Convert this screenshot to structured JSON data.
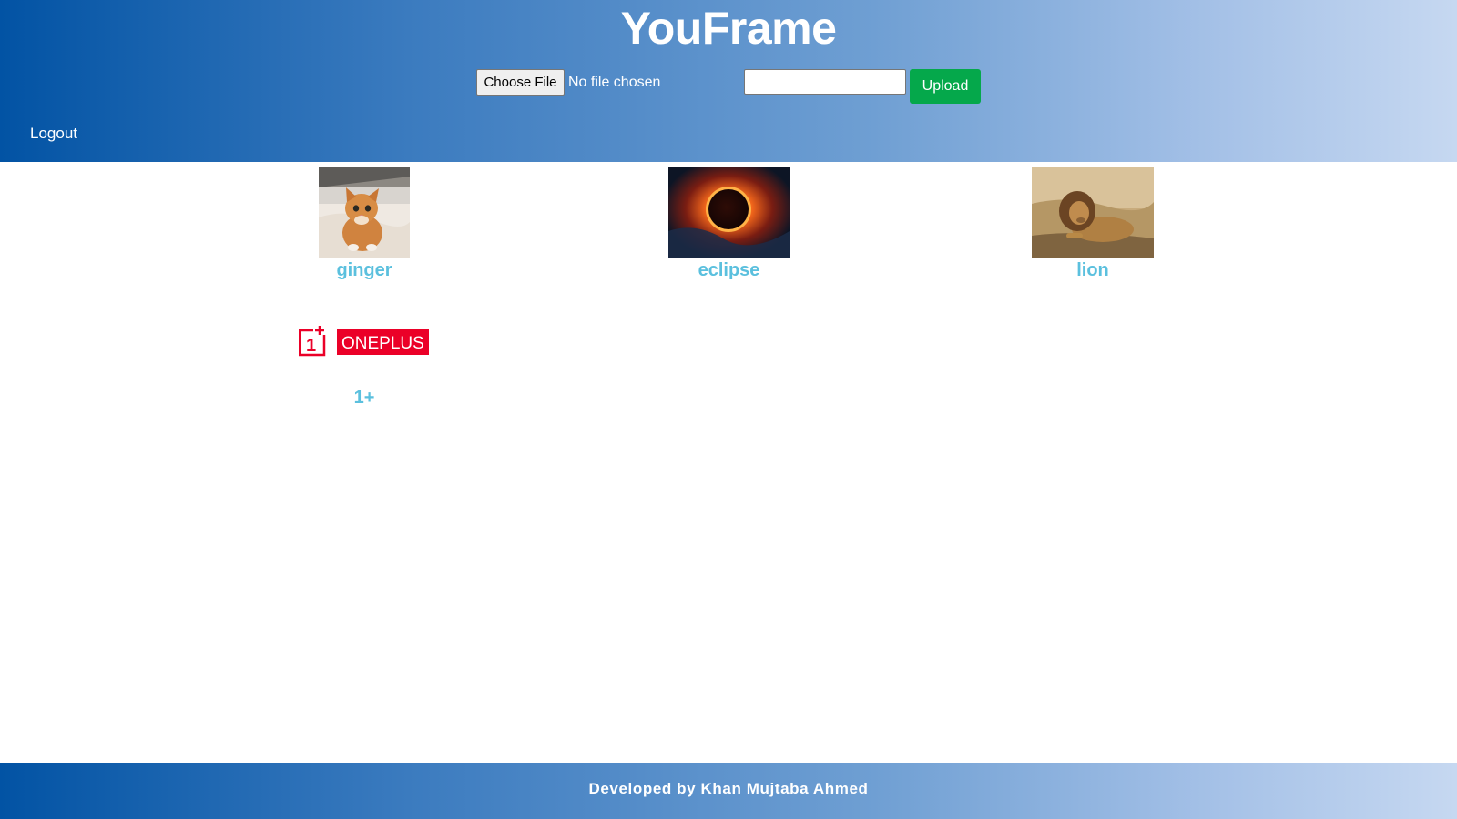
{
  "header": {
    "title": "YouFrame",
    "file_button_label": "Choose File",
    "file_status": "No file chosen",
    "name_input_value": "",
    "upload_label": "Upload",
    "logout_label": "Logout"
  },
  "gallery": {
    "items": [
      {
        "label": "ginger",
        "image": "orange-kitten-photo"
      },
      {
        "label": "eclipse",
        "image": "solar-eclipse-photo"
      },
      {
        "label": "lion",
        "image": "lion-on-grass-photo"
      },
      {
        "label": "1+",
        "image": "oneplus-logo",
        "logo_text": "ONEPLUS",
        "logo_mark": "1+"
      }
    ]
  },
  "footer": {
    "credit": "Developed by Khan Mujtaba Ahmed"
  },
  "colors": {
    "header_gradient_start": "#0253a4",
    "header_gradient_end": "#c6d8f1",
    "upload_button": "#05a84b",
    "item_label": "#5bc0de",
    "oneplus_red": "#eb0028"
  }
}
